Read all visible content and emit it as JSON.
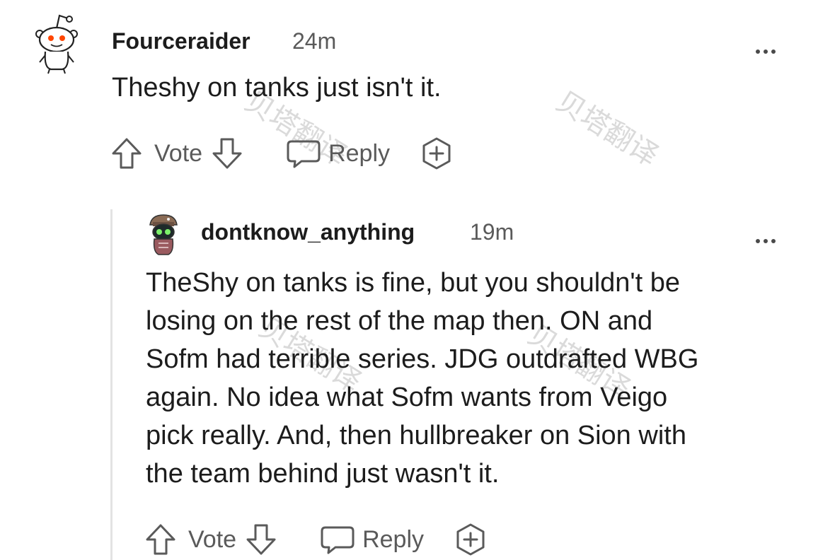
{
  "comments": [
    {
      "username": "Fourceraider",
      "time": "24m",
      "body": "Theshy on tanks just isn't it.",
      "vote_label": "Vote",
      "reply_label": "Reply"
    },
    {
      "username": "dontknow_anything",
      "time": "19m",
      "body_lines": [
        "TheShy on tanks is fine, but you shouldn't be",
        "losing on the rest of the map then. ON and",
        "Sofm had terrible series. JDG outdrafted WBG",
        "again. No idea what Sofm wants from Veigo",
        "pick really. And, then hullbreaker on Sion with",
        "the team behind just wasn't it."
      ],
      "vote_label": "Vote",
      "reply_label": "Reply"
    }
  ],
  "watermarks": [
    "贝塔翻译",
    "贝塔翻译",
    "贝塔翻译",
    "贝塔翻译"
  ]
}
